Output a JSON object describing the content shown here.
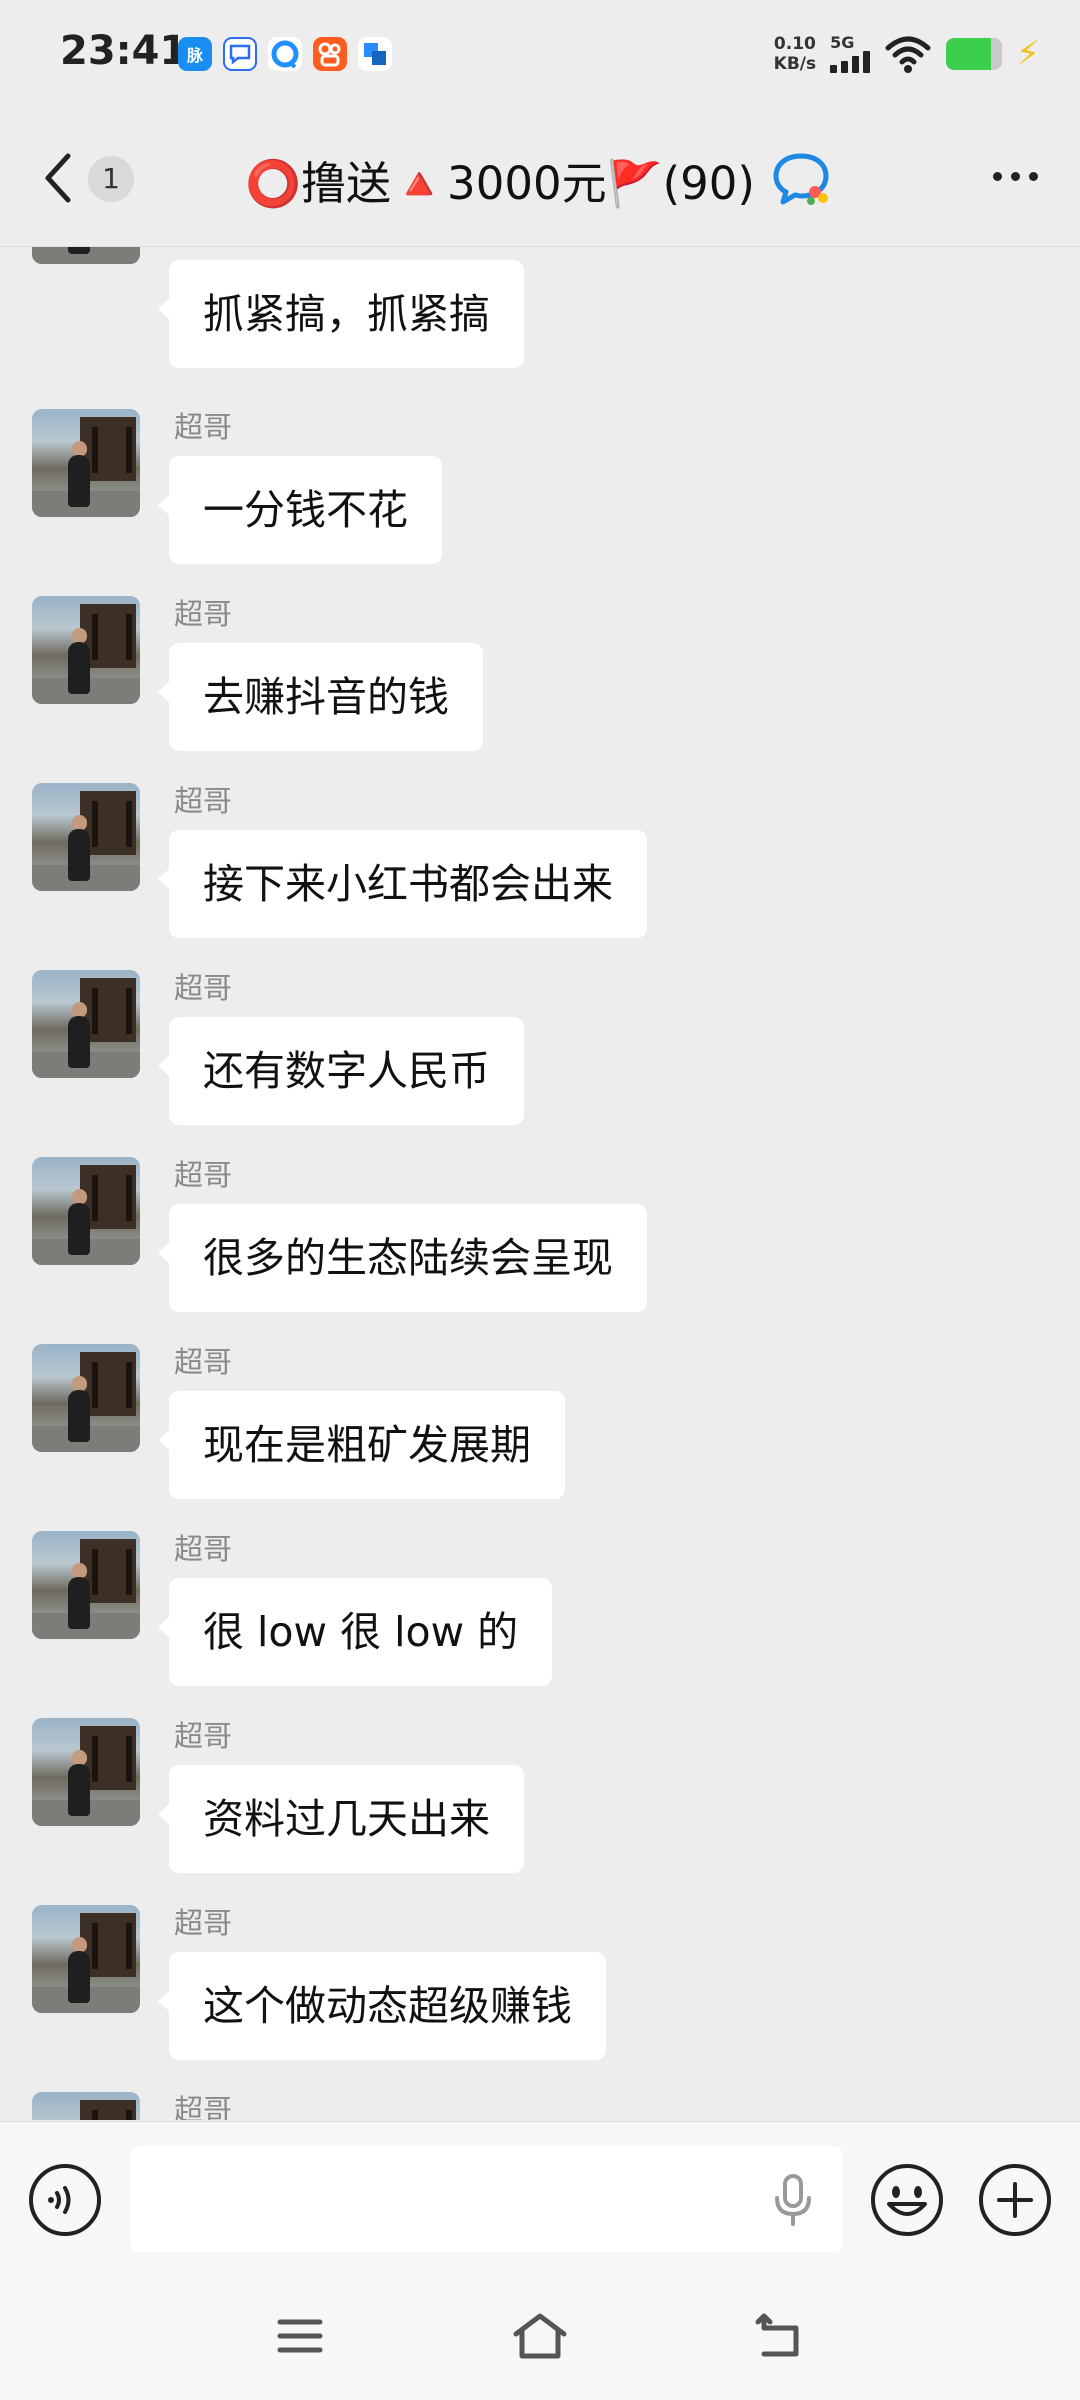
{
  "status_bar": {
    "time": "23:41",
    "net_speed_value": "0.10",
    "net_speed_unit": "KB/s",
    "network": "5G",
    "battery_level": 0.8,
    "notification_icons": [
      {
        "name": "maimai-icon",
        "label": "脉",
        "color": "#1a8df0"
      },
      {
        "name": "chat-app-icon",
        "label": "",
        "color": "#2d6df6"
      },
      {
        "name": "browser-icon",
        "label": "",
        "color": "#1e90ff"
      },
      {
        "name": "kuaishou-icon",
        "label": "",
        "color": "#ff5c1f"
      },
      {
        "name": "app-icon",
        "label": "",
        "color": "#2b8cff"
      }
    ]
  },
  "header": {
    "back_count": "1",
    "title": "⭕撸送🔺3000元🚩(90)"
  },
  "messages": [
    {
      "sender": "超哥",
      "text": "抓紧搞，抓紧搞"
    },
    {
      "sender": "超哥",
      "text": "一分钱不花"
    },
    {
      "sender": "超哥",
      "text": "去赚抖音的钱"
    },
    {
      "sender": "超哥",
      "text": "接下来小红书都会出来"
    },
    {
      "sender": "超哥",
      "text": "还有数字人民币"
    },
    {
      "sender": "超哥",
      "text": "很多的生态陆续会呈现"
    },
    {
      "sender": "超哥",
      "text": "现在是粗矿发展期"
    },
    {
      "sender": "超哥",
      "text": "很 low 很 low 的"
    },
    {
      "sender": "超哥",
      "text": "资料过几天出来"
    },
    {
      "sender": "超哥",
      "text": "这个做动态超级赚钱"
    },
    {
      "sender": "超哥",
      "text": ""
    }
  ],
  "input_bar": {
    "placeholder": ""
  },
  "colors": {
    "background": "#ededed",
    "bubble": "#ffffff",
    "sender_text": "#8a8a8a",
    "battery_fill": "#3ccf4e",
    "charging_bolt": "#f4c21b"
  }
}
